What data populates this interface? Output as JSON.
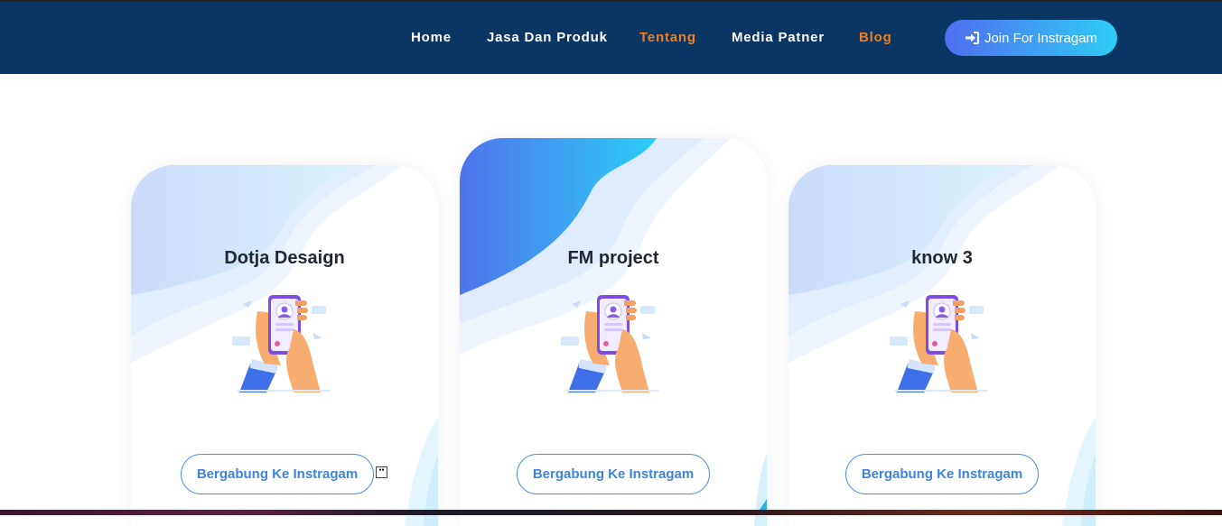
{
  "nav": {
    "items": [
      {
        "label": "Home",
        "color": "#ffffff"
      },
      {
        "label": "Jasa Dan Produk",
        "color": "#ffffff"
      },
      {
        "label": "Tentang",
        "color": "#f07f24"
      },
      {
        "label": "Media Patner",
        "color": "#ffffff"
      },
      {
        "label": "Blog",
        "color": "#f07f24"
      }
    ],
    "join_button": {
      "label": "Join For Instragam",
      "icon": "sign-in-icon"
    }
  },
  "cards": [
    {
      "title": "Dotja Desaign",
      "button_label": "Bergabung Ke Instragam",
      "illustration": "phone-profile-illustration"
    },
    {
      "title": "FM project",
      "button_label": "Bergabung Ke Instragam",
      "illustration": "phone-profile-illustration"
    },
    {
      "title": "know 3",
      "button_label": "Bergabung Ke Instragam",
      "illustration": "phone-profile-illustration"
    }
  ],
  "colors": {
    "navbar_bg": "#0b3563",
    "accent_orange": "#f07f24",
    "gradient_start": "#4f6ef0",
    "gradient_end": "#2fcdf5",
    "button_text": "#3e84dc"
  }
}
